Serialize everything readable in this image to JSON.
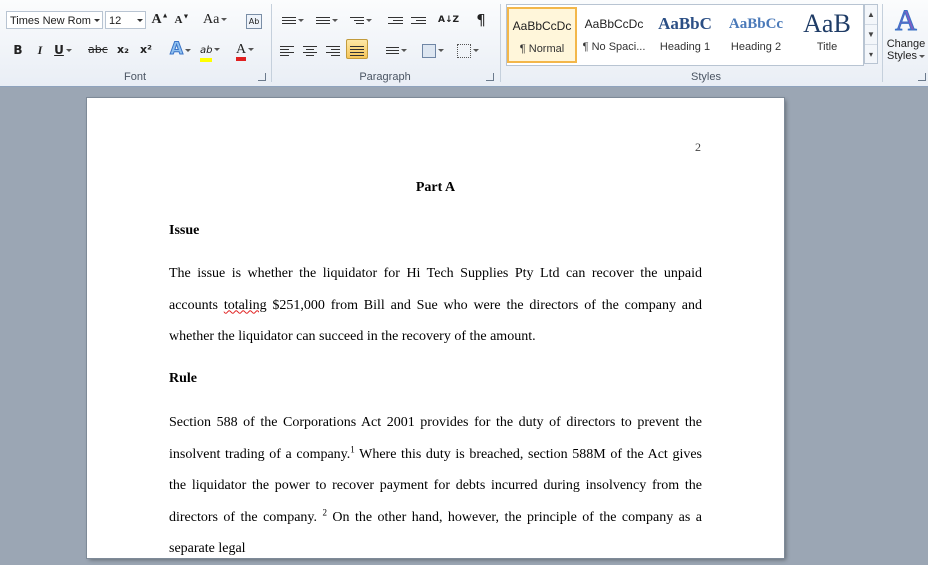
{
  "ribbon": {
    "font": {
      "label": "Font",
      "font_name": "Times New Rom",
      "font_size": "12",
      "grow_label": "A",
      "shrink_label": "A",
      "case_label": "Aa",
      "bold": "B",
      "italic": "I",
      "underline": "U",
      "strike": "abc",
      "subscript": "x₂",
      "superscript": "x²",
      "text_effects": "A",
      "highlight": "ab",
      "font_color": "A"
    },
    "paragraph": {
      "label": "Paragraph",
      "sort": "A↓Z",
      "pilcrow": "¶"
    },
    "styles": {
      "label": "Styles",
      "items": [
        {
          "sample": "AaBbCcDc",
          "name": "¶ Normal"
        },
        {
          "sample": "AaBbCcDc",
          "name": "¶ No Spaci..."
        },
        {
          "sample": "AaBbC",
          "name": "Heading 1"
        },
        {
          "sample": "AaBbCc",
          "name": "Heading 2"
        },
        {
          "sample": "AaB",
          "name": "Title"
        }
      ],
      "change_styles_line1": "Change",
      "change_styles_line2": "Styles"
    },
    "colors": {
      "highlight": "#ffff00",
      "font_color": "#e02020",
      "accent": "#3a73c7"
    }
  },
  "document": {
    "page_number": "2",
    "title": "Part A",
    "issue_heading": "Issue",
    "issue_para_part1": "The issue is whether the liquidator for Hi Tech Supplies Pty Ltd can recover the unpaid accounts ",
    "issue_para_misspelled": "totaling",
    "issue_para_part2": " $251,000 from Bill and Sue who were the directors of the company and whether the liquidator can succeed in the recovery of the amount.",
    "rule_heading": "Rule",
    "rule_para_part1": "Section 588 of the Corporations Act 2001 provides for the duty of directors to prevent the insolvent trading of a company.",
    "rule_fn1": "1",
    "rule_para_part2": " Where this duty is breached, section 588M of the Act gives the liquidator the power to recover payment for debts incurred during insolvency from the directors of the company. ",
    "rule_fn2": "2",
    "rule_para_part3": " On the other hand, however, the principle of the company as a separate legal"
  }
}
